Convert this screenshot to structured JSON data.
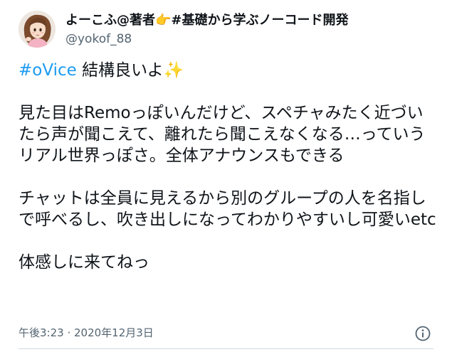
{
  "tweet": {
    "author": {
      "display_name": "よーこふ@著者👉#基礎から学ぶノーコード開発",
      "handle": "@yokof_88"
    },
    "hashtag": "#oVice",
    "first_line_rest": " 結構良いよ✨",
    "paragraphs": [
      "見た目はRemoっぽいんだけど、スペチャみたく近づいたら声が聞こえて、離れたら聞こえなくなる…っていうリアル世界っぽさ。全体アナウンスもできる",
      "チャットは全員に見えるから別のグループの人を名指しで呼べるし、吹き出しになってわかりやすいし可愛いetc",
      "体感しに来てねっ"
    ],
    "timestamp": "午後3:23 · 2020年12月3日"
  },
  "colors": {
    "link": "#1d9bf0",
    "text": "#0f1419",
    "muted": "#536471"
  },
  "icons": {
    "info": "info-circle-icon",
    "avatar": "avatar-illustration"
  }
}
